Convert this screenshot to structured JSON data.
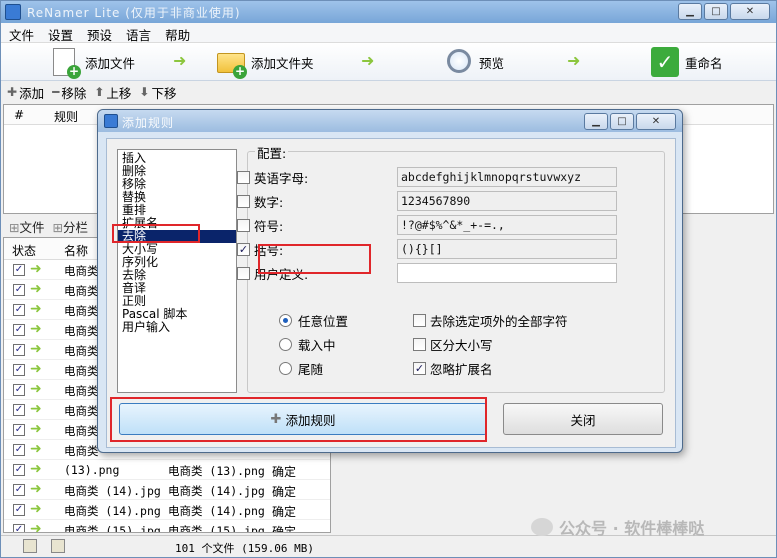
{
  "main_window": {
    "title": "ReNamer Lite (仅用于非商业使用)",
    "menu": [
      "文件",
      "设置",
      "预设",
      "语言",
      "帮助"
    ],
    "toolbar": {
      "add_files": "添加文件",
      "add_folder": "添加文件夹",
      "preview": "预览",
      "rename": "重命名"
    },
    "rules_toolbar": {
      "add": "添加",
      "remove": "移除",
      "move_up": "上移",
      "move_down": "下移"
    },
    "rules_table_headers": [
      "#",
      "规则"
    ],
    "file_tabs": [
      "文件",
      "分栏"
    ],
    "file_table_headers": [
      "状态",
      "名称"
    ],
    "file_rows": [
      {
        "name": "电商类",
        "new_name": "",
        "state": ""
      },
      {
        "name": "电商类",
        "new_name": "",
        "state": ""
      },
      {
        "name": "电商类",
        "new_name": "",
        "state": ""
      },
      {
        "name": "电商类",
        "new_name": "",
        "state": ""
      },
      {
        "name": "电商类",
        "new_name": "",
        "state": ""
      },
      {
        "name": "电商类",
        "new_name": "",
        "state": ""
      },
      {
        "name": "电商类",
        "new_name": "",
        "state": ""
      },
      {
        "name": "电商类",
        "new_name": "",
        "state": ""
      },
      {
        "name": "电商类",
        "new_name": "",
        "state": ""
      },
      {
        "name": "电商类",
        "new_name": "",
        "state": ""
      },
      {
        "name": "(13).png",
        "new_name": "电商类 (13).png",
        "state": "确定"
      },
      {
        "name": "电商类 (14).jpg",
        "new_name": "电商类 (14).jpg",
        "state": "确定"
      },
      {
        "name": "电商类 (14).png",
        "new_name": "电商类 (14).png",
        "state": "确定"
      },
      {
        "name": "电商类 (15).jpg",
        "new_name": "电商类 (15).jpg",
        "state": "确定"
      },
      {
        "name": "电商类 (15).png",
        "new_name": "电商类 (15).png",
        "state": "确定"
      }
    ],
    "status_text": "101 个文件 (159.06 MB)"
  },
  "dialog": {
    "title": "添加规则",
    "rule_types": [
      "插入",
      "删除",
      "移除",
      "替换",
      "重排",
      "扩展名",
      "去除",
      "大小写",
      "序列化",
      "去除",
      "音译",
      "正则",
      "Pascal 脚本",
      "用户输入"
    ],
    "selected_rule_index": 6,
    "config_label": "配置:",
    "options": [
      {
        "label": "英语字母:",
        "checked": false,
        "value": "abcdefghijklmnopqrstuvwxyz"
      },
      {
        "label": "数字:",
        "checked": false,
        "value": "1234567890"
      },
      {
        "label": "符号:",
        "checked": false,
        "value": "!?@#$%^&*_+-=.,"
      },
      {
        "label": "括号:",
        "checked": true,
        "value": "(){}[]"
      },
      {
        "label": "用户定义:",
        "checked": false,
        "value": ""
      }
    ],
    "position_options": [
      {
        "label": "任意位置",
        "selected": true
      },
      {
        "label": "载入中",
        "selected": false
      },
      {
        "label": "尾随",
        "selected": false
      }
    ],
    "flag_options": [
      {
        "label": "去除选定项外的全部字符",
        "checked": false
      },
      {
        "label": "区分大小写",
        "checked": false
      },
      {
        "label": "忽略扩展名",
        "checked": true
      }
    ],
    "add_rule_button": "添加规则",
    "close_button": "关闭"
  },
  "watermark": "公众号 · 软件棒棒哒"
}
